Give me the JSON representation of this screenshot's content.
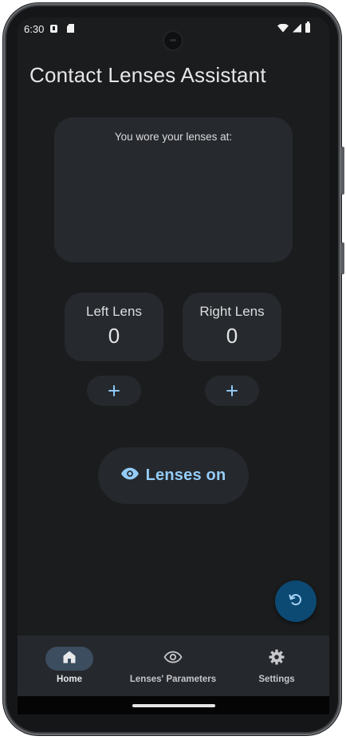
{
  "status_bar": {
    "time": "6:30",
    "icons": [
      "notification-a-icon",
      "sd-card-icon",
      "wifi-icon",
      "signal-icon",
      "battery-icon"
    ]
  },
  "app": {
    "title": "Contact Lenses Assistant"
  },
  "info_card": {
    "label": "You wore your lenses at:"
  },
  "lenses": {
    "left": {
      "label": "Left Lens",
      "count": "0"
    },
    "right": {
      "label": "Right Lens",
      "count": "0"
    }
  },
  "actions": {
    "add_left_icon": "plus-icon",
    "add_right_icon": "plus-icon",
    "lenses_on_label": "Lenses on",
    "lenses_on_icon": "eye-icon",
    "reset_icon": "refresh-icon"
  },
  "bottom_nav": {
    "items": [
      {
        "label": "Home",
        "icon": "home-icon",
        "selected": true
      },
      {
        "label": "Lenses' Parameters",
        "icon": "eye-outline-icon",
        "selected": false
      },
      {
        "label": "Settings",
        "icon": "gear-icon",
        "selected": false
      }
    ]
  },
  "colors": {
    "background": "#1b1c1e",
    "surface": "#26292d",
    "accent": "#94ccf8",
    "fab": "#0c4a73",
    "nav_selected_pill": "#3b4d5f"
  }
}
